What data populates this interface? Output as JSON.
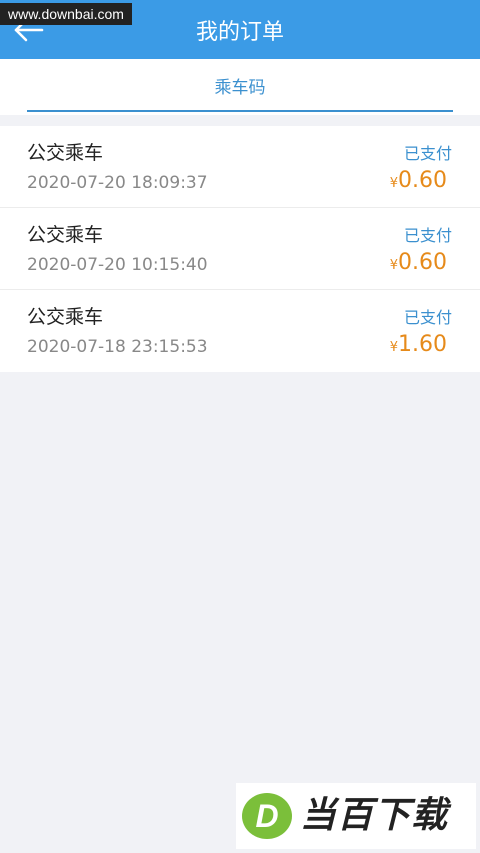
{
  "watermark": {
    "text": "www.downbai.com"
  },
  "header": {
    "title": "我的订单"
  },
  "tabs": [
    {
      "label": "乘车码",
      "active": true
    }
  ],
  "orders": [
    {
      "title": "公交乘车",
      "time": "2020-07-20 18:09:37",
      "status": "已支付",
      "currency": "¥",
      "amount": "0.60"
    },
    {
      "title": "公交乘车",
      "time": "2020-07-20 10:15:40",
      "status": "已支付",
      "currency": "¥",
      "amount": "0.60"
    },
    {
      "title": "公交乘车",
      "time": "2020-07-18 23:15:53",
      "status": "已支付",
      "currency": "¥",
      "amount": "1.60"
    }
  ],
  "logo": {
    "badge_letter": "D",
    "text": "当百下载"
  },
  "colors": {
    "header": "#3b9be6",
    "accent": "#3b90cf",
    "amount": "#e68a1a",
    "background": "#f1f2f6",
    "logo_green": "#7bbf3a"
  }
}
